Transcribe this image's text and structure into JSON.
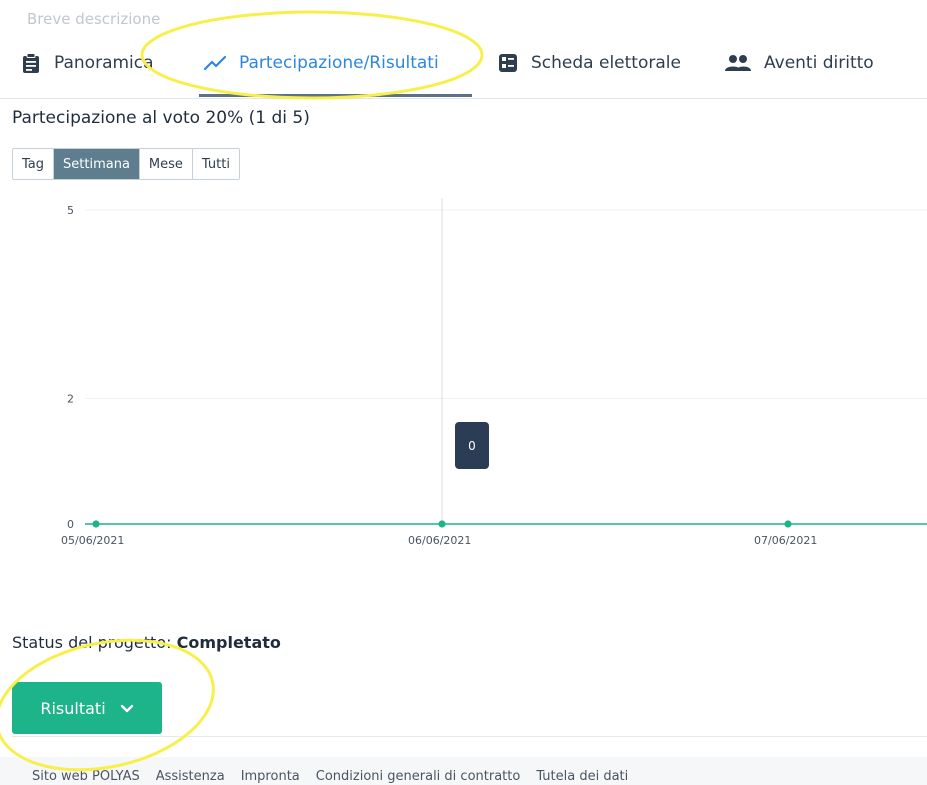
{
  "header": {
    "faded_text": "Breve descrizione"
  },
  "tabs": [
    {
      "label": "Panoramica",
      "icon": "clipboard-icon"
    },
    {
      "label": "Partecipazione/Risultati",
      "icon": "trend-line-icon",
      "active": true
    },
    {
      "label": "Scheda elettorale",
      "icon": "ballot-icon"
    },
    {
      "label": "Aventi diritto",
      "icon": "people-icon"
    }
  ],
  "section_title": "Partecipazione al voto 20% (1 di 5)",
  "range_buttons": [
    {
      "label": "Tag"
    },
    {
      "label": "Settimana",
      "active": true
    },
    {
      "label": "Mese"
    },
    {
      "label": "Tutti"
    }
  ],
  "chart_data": {
    "type": "line",
    "x": [
      "05/06/2021",
      "06/06/2021",
      "07/06/2021"
    ],
    "series": [
      {
        "values": [
          0,
          0,
          0
        ]
      }
    ],
    "y_ticks": [
      0,
      2,
      5
    ],
    "ylim": [
      0,
      5
    ],
    "tooltip": {
      "value": "0",
      "at": "06/06/2021"
    },
    "colors": {
      "line": "#1db489",
      "tooltip_bg": "#2b3d55"
    }
  },
  "status": {
    "label": "Status del progetto:",
    "value": "Completato"
  },
  "results_button": {
    "label": "Risultati",
    "icon": "chevron-down-icon"
  },
  "footer": {
    "links": [
      "Sito web POLYAS",
      "Assistenza",
      "Impronta",
      "Condizioni generali di contratto",
      "Tutela dei dati"
    ]
  },
  "colors": {
    "accent": "#2e86de",
    "primary_button": "#1db489",
    "highlight": "#f7f04a"
  }
}
